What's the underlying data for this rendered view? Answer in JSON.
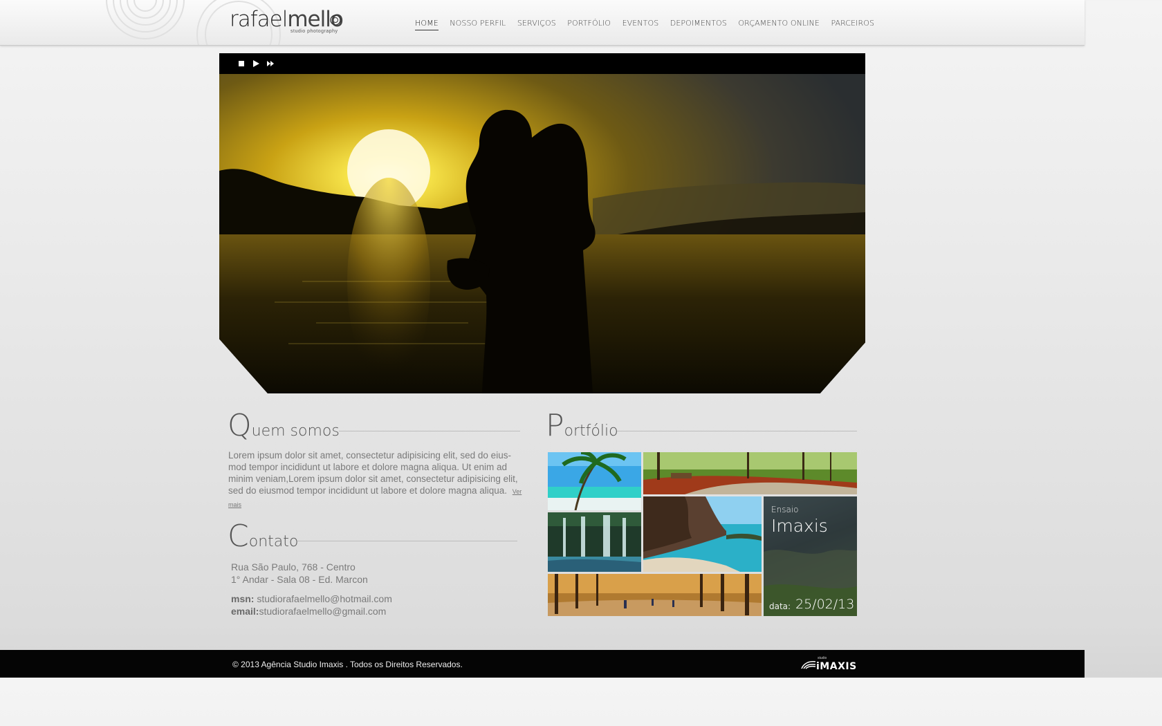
{
  "header": {
    "logo_main": "rafael",
    "logo_thin": "mello",
    "logo_sub": "studio photography",
    "nav": [
      {
        "label": "HOME",
        "active": true
      },
      {
        "label": "NOSSO PERFIL"
      },
      {
        "label": "SERVIÇOS"
      },
      {
        "label": "PORTFÓLIO"
      },
      {
        "label": "EVENTOS"
      },
      {
        "label": "DEPOIMENTOS"
      },
      {
        "label": "ORÇAMENTO ONLINE"
      },
      {
        "label": "PARCEIROS"
      }
    ]
  },
  "slider": {
    "controls": [
      "stop-icon",
      "play-icon",
      "fast-forward-icon"
    ]
  },
  "about": {
    "title_initial": "Q",
    "title_rest": "uem somos",
    "text": "Lorem ipsum dolor sit amet, consectetur adipisicing elit, sed do eius-mod tempor incididunt ut labore et dolore magna aliqua. Ut enim ad minim veniam,Lorem ipsum dolor sit amet, consectetur adipisicing elit, sed do eiusmod tempor incididunt ut labore et dolore magna aliqua.",
    "more_label": "Ver mais"
  },
  "contact": {
    "title_initial": "C",
    "title_rest": "ontato",
    "address1": "Rua São Paulo, 768 - Centro",
    "address2": "1° Andar - Sala 08 - Ed. Marcon",
    "msn_label": "msn:",
    "msn_value": " studiorafaelmello@hotmail.com",
    "email_label": "email:",
    "email_value": "studiorafaelmello@gmail.com"
  },
  "portfolio": {
    "title_initial": "P",
    "title_rest": "ortfólio",
    "featured": {
      "label_small": "Ensaio",
      "label_big": "Imaxis",
      "date_label": "data:",
      "date_value": "25/02/13"
    }
  },
  "footer": {
    "copyright": "© 2013 Agência Studio Imaxis . Todos os Direitos Reservados.",
    "brand_small": "studio",
    "brand": "iMAXIS"
  }
}
